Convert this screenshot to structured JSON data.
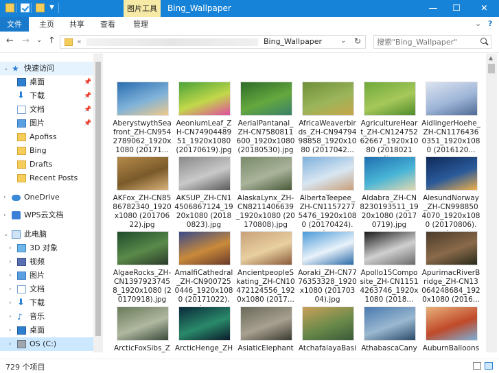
{
  "window": {
    "title": "Bing_Wallpaper",
    "context_tab": "图片工具",
    "controls": {
      "minimize": "—",
      "maximize": "☐",
      "close": "✕"
    }
  },
  "ribbon": {
    "tabs": [
      "文件",
      "主页",
      "共享",
      "查看",
      "管理"
    ],
    "collapse": "⌄",
    "help": "?"
  },
  "nav": {
    "back": "←",
    "forward": "→",
    "recent": "⌄",
    "up": "↑",
    "address_chevron": "«",
    "address_current": "Bing_Wallpaper",
    "address_dropdown": "⌄",
    "refresh": "↻",
    "search_placeholder": "搜索\"Bing_Wallpaper\""
  },
  "sidebar": [
    {
      "label": "快速访问",
      "icon": "star-icon"
    },
    {
      "label": "桌面",
      "icon": "desktop-icon",
      "pinned": true
    },
    {
      "label": "下载",
      "icon": "download-icon",
      "pinned": true
    },
    {
      "label": "文档",
      "icon": "document-icon",
      "pinned": true
    },
    {
      "label": "图片",
      "icon": "picture-icon",
      "pinned": true
    },
    {
      "label": "Apofiss",
      "icon": "folder-icon"
    },
    {
      "label": "Bing",
      "icon": "folder-icon"
    },
    {
      "label": "Drafts",
      "icon": "folder-icon"
    },
    {
      "label": "Recent Posts",
      "icon": "folder-icon"
    },
    {
      "label": "OneDrive",
      "icon": "cloud-icon"
    },
    {
      "label": "WPS云文档",
      "icon": "wps-icon"
    },
    {
      "label": "此电脑",
      "icon": "computer-icon"
    },
    {
      "label": "3D 对象",
      "icon": "3d-objects-icon"
    },
    {
      "label": "视频",
      "icon": "video-icon"
    },
    {
      "label": "图片",
      "icon": "picture-icon"
    },
    {
      "label": "文档",
      "icon": "document-icon"
    },
    {
      "label": "下载",
      "icon": "download-icon"
    },
    {
      "label": "音乐",
      "icon": "music-icon"
    },
    {
      "label": "桌面",
      "icon": "desktop-icon"
    },
    {
      "label": "OS (C:)",
      "icon": "drive-icon"
    }
  ],
  "sidebar_arrows": {
    "expanded": "⌄",
    "collapsed": "›"
  },
  "pin_glyph": "📌",
  "files": [
    {
      "name": "AberystwythSeafront_ZH-CN9542789062_1920x1080 (20171...",
      "colors": [
        "#2a6db0",
        "#7fb2d9",
        "#f0c98a"
      ]
    },
    {
      "name": "AeoniumLeaf_ZH-CN7490448951_1920x1080 (20170619).jpg",
      "colors": [
        "#4aa23a",
        "#c2d84a",
        "#e04aa0"
      ]
    },
    {
      "name": "AerialPantanal_ZH-CN7580811600_1920x1080 (20180530).jpg",
      "colors": [
        "#2f6b2a",
        "#64a83e",
        "#3a7f6a"
      ]
    },
    {
      "name": "AfricaWeaverbirds_ZH-CN9479498858_1920x1080 (2017042...",
      "colors": [
        "#6e8f3a",
        "#9bb55a",
        "#c7a54a"
      ]
    },
    {
      "name": "AgricultureHeart_ZH-CN12475262667_1920x1080 (20180214)...",
      "colors": [
        "#6fa83a",
        "#a6c85a",
        "#4f8a2a"
      ]
    },
    {
      "name": "AidlingerHoehe_ZH-CN11764360351_1920x1080 (2016120...",
      "colors": [
        "#dbe3f0",
        "#9fb6d8",
        "#506a94"
      ]
    },
    {
      "name": "AKFox_ZH-CN8586782340_1920x1080 (20170622).jpg",
      "colors": [
        "#b58a4a",
        "#7a5a2a",
        "#d9b27a"
      ]
    },
    {
      "name": "AKSUP_ZH-CN14506867124_1920x1080 (20180823).jpg",
      "colors": [
        "#8a8a8a",
        "#c9c9c9",
        "#5a5a5a"
      ]
    },
    {
      "name": "AlaskaLynx_ZH-CN8211406639_1920x1080 (20170808).jpg",
      "colors": [
        "#7a8a6a",
        "#a9b39a",
        "#4a5a3a"
      ]
    },
    {
      "name": "AlbertaTeepee_ZH-CN11572775476_1920x1080 (20170424).j...",
      "colors": [
        "#7fb0dc",
        "#d8e6f2",
        "#c9a07a"
      ]
    },
    {
      "name": "Aldabra_ZH-CN8230193511_1920x1080 (20170719).jpg",
      "colors": [
        "#1f6fb0",
        "#49b5d6",
        "#e2d8b0"
      ]
    },
    {
      "name": "AlesundNorway_ZH-CN9988504070_1920x1080 (20170806).j...",
      "colors": [
        "#0f2a5a",
        "#2a5a9a",
        "#f0b04a"
      ]
    },
    {
      "name": "AlgaeRocks_ZH-CN13979237458_1920x1080 (20170918).jpg",
      "colors": [
        "#1f4a2a",
        "#5a8a4a",
        "#2a3a2a"
      ]
    },
    {
      "name": "AmalfiCathedral_ZH-CN9007250446_1920x1080 (20171022).j...",
      "colors": [
        "#3a4a8a",
        "#c98a3a",
        "#6a3a2a"
      ]
    },
    {
      "name": "AncientpeopleSkating_ZH-CN10472124556_1920x1080 (2017...",
      "colors": [
        "#c9a07a",
        "#e8d0a0",
        "#8a5a3a"
      ]
    },
    {
      "name": "Aoraki_ZH-CN7776353328_1920x1080 (20170304).jpg",
      "colors": [
        "#4a9ad8",
        "#e8f2fa",
        "#2a6aa8"
      ]
    },
    {
      "name": "Apollo15Composite_ZH-CN11514263746_1920x1080 (2018...",
      "colors": [
        "#1a1a1a",
        "#d0d0d0",
        "#6a6a6a"
      ]
    },
    {
      "name": "ApurimacRiverBridge_ZH-CN13064248684_1920x1080 (2016...",
      "colors": [
        "#4a3a2a",
        "#8a6a4a",
        "#2a2a1a"
      ]
    },
    {
      "name": "ArcticFoxSibs_ZH-CN74174519",
      "colors": [
        "#6a7a5a",
        "#b0b8a0",
        "#3a4a3a"
      ]
    },
    {
      "name": "ArcticHenge_ZH-CN819798239",
      "colors": [
        "#0a2a3a",
        "#2a8a6a",
        "#0a1a2a"
      ]
    },
    {
      "name": "AsiaticElephant_ZH-CN1223208",
      "colors": [
        "#6a6a5a",
        "#a8a090",
        "#3a3a30"
      ]
    },
    {
      "name": "AtchafalayaBasin_ZH-CN11978",
      "colors": [
        "#c8a05a",
        "#6a8a4a",
        "#3a5a3a"
      ]
    },
    {
      "name": "AthabascaCanyon_ZH-CN1103",
      "colors": [
        "#4a7ab0",
        "#9ab8d0",
        "#2a4a6a"
      ]
    },
    {
      "name": "AuburnBalloons_ZH-CN864912",
      "colors": [
        "#e8b07a",
        "#c04a2a",
        "#7ab0d8"
      ]
    }
  ],
  "status": {
    "count": "729 个项目"
  }
}
